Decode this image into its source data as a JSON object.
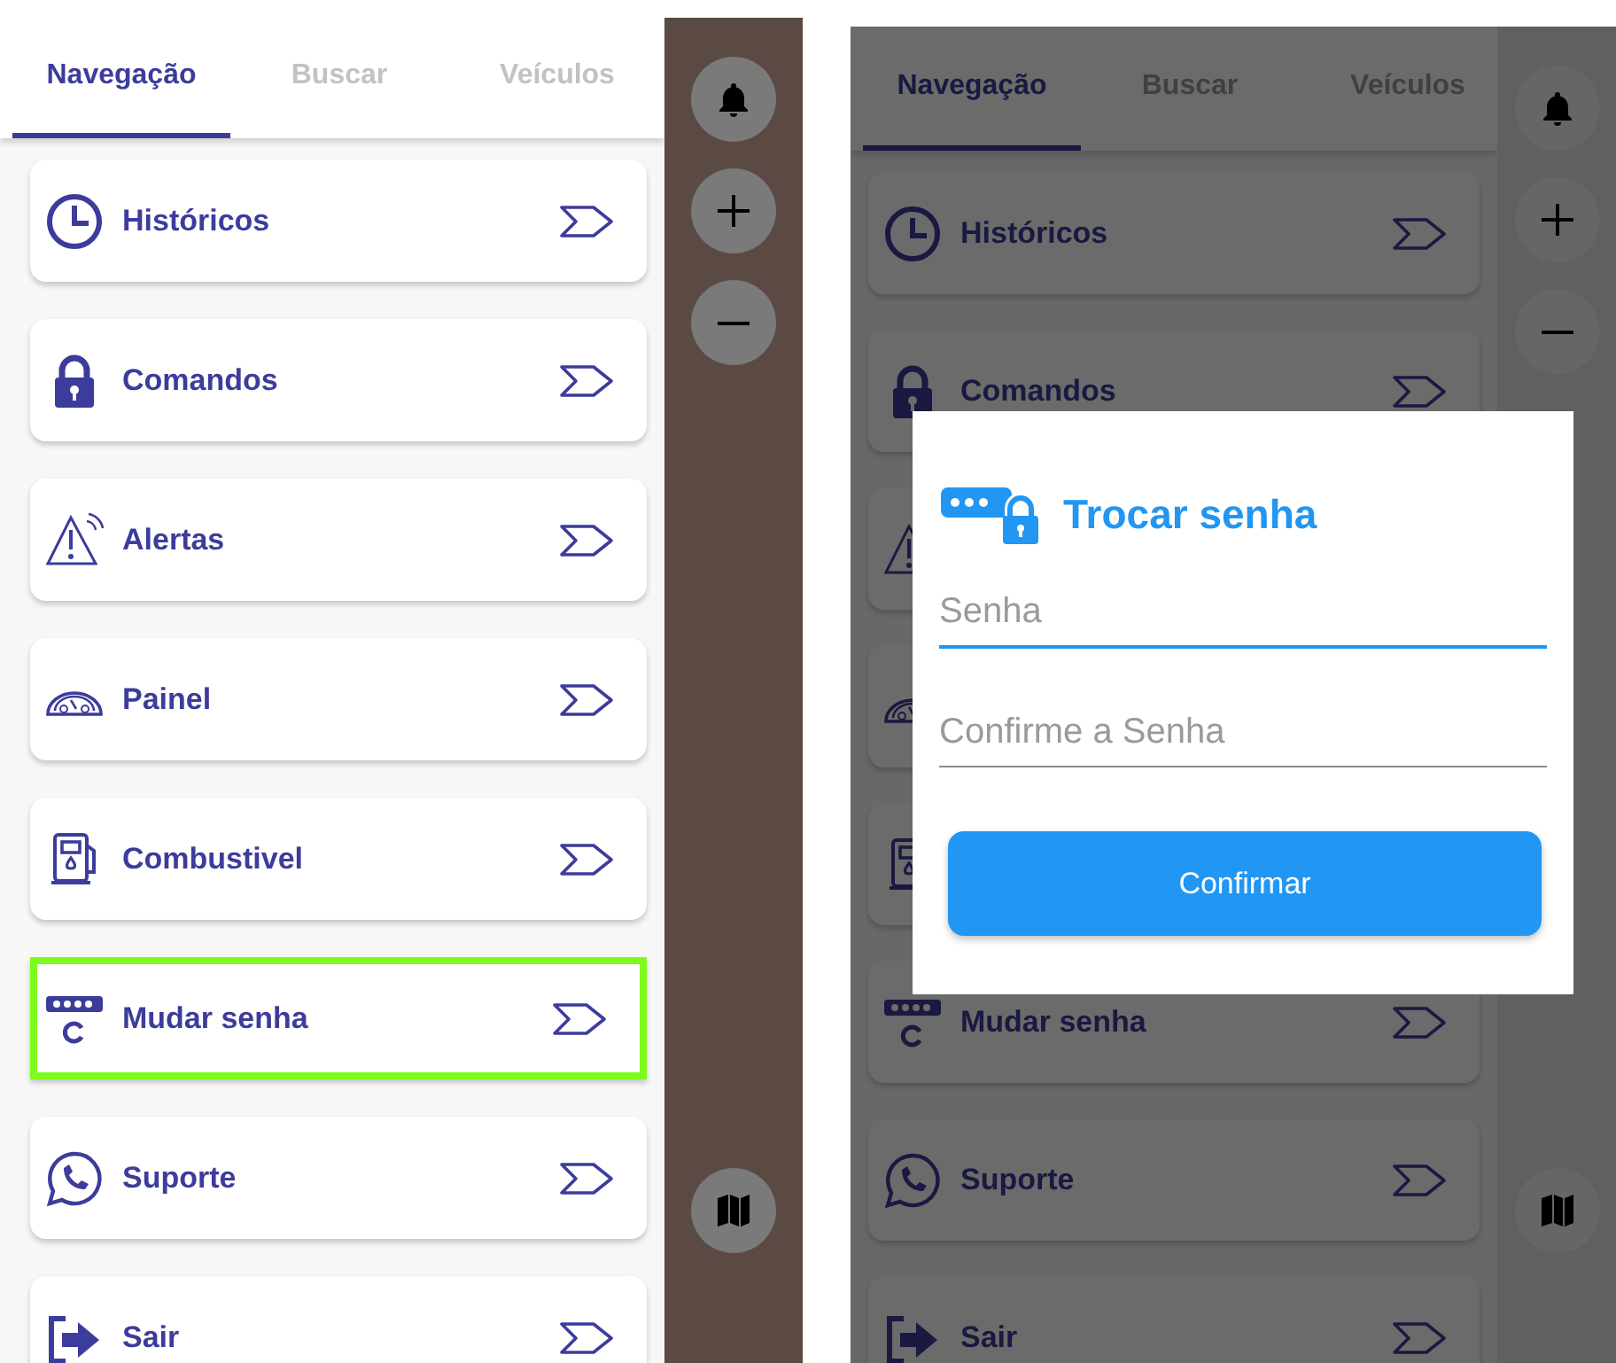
{
  "screens": [
    {
      "tabs": [
        {
          "label": "Navegação",
          "selected": true
        },
        {
          "label": "Buscar",
          "selected": false
        },
        {
          "label": "Veículos",
          "selected": false
        }
      ],
      "menu": [
        {
          "kind": "history",
          "label": "Históricos",
          "highlighted": false
        },
        {
          "kind": "lock",
          "label": "Comandos",
          "highlighted": false
        },
        {
          "kind": "alert",
          "label": "Alertas",
          "highlighted": false
        },
        {
          "kind": "dashboard",
          "label": "Painel",
          "highlighted": false
        },
        {
          "kind": "fuel",
          "label": "Combustivel",
          "highlighted": false
        },
        {
          "kind": "password",
          "label": "Mudar senha",
          "highlighted": true
        },
        {
          "kind": "support",
          "label": "Suporte",
          "highlighted": false
        },
        {
          "kind": "exit",
          "label": "Sair",
          "highlighted": false
        }
      ]
    },
    {
      "tabs": [
        {
          "label": "Navegação",
          "selected": true
        },
        {
          "label": "Buscar",
          "selected": false
        },
        {
          "label": "Veículos",
          "selected": false
        }
      ],
      "menu": [
        {
          "kind": "history",
          "label": "Históricos",
          "highlighted": false
        },
        {
          "kind": "lock",
          "label": "Comandos",
          "highlighted": false
        },
        {
          "kind": "alert",
          "highlighted": false
        },
        {
          "kind": "dashboard",
          "highlighted": false
        },
        {
          "kind": "fuel",
          "highlighted": false
        },
        {
          "kind": "password",
          "label": "Mudar senha",
          "highlighted": false
        },
        {
          "kind": "support",
          "label": "Suporte",
          "highlighted": false
        },
        {
          "kind": "exit",
          "label": "Sair",
          "highlighted": false
        }
      ],
      "dialog": {
        "title": "Trocar senha",
        "fields": [
          {
            "placeholder": "Senha",
            "focused": true
          },
          {
            "placeholder": "Confirme a Senha",
            "focused": false
          }
        ],
        "button": "Confirmar"
      }
    }
  ]
}
